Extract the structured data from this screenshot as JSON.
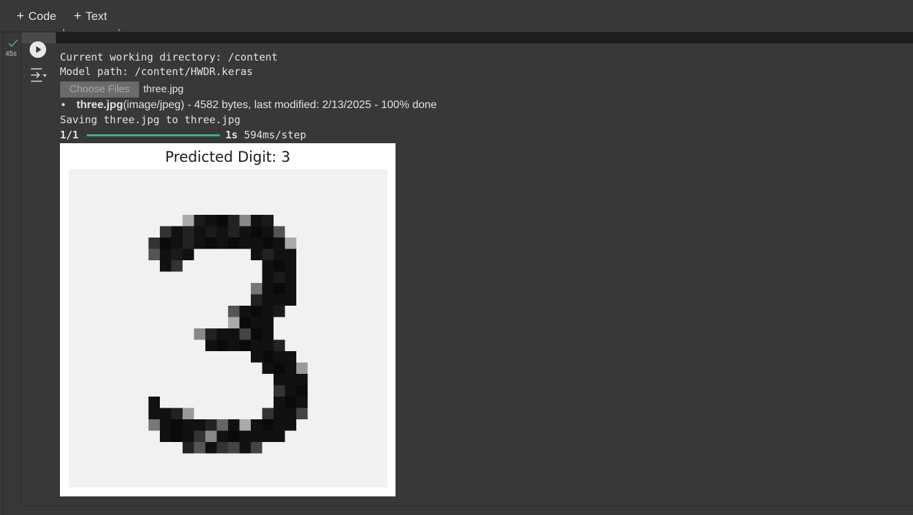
{
  "toolbar": {
    "add_code_label": "Code",
    "add_text_label": "Text",
    "plus_glyph": "+"
  },
  "cell": {
    "execution_time": "45s",
    "status_icon": "check-icon",
    "accent_color": "#39b58f"
  },
  "output": {
    "cwd_line": "Current working directory: /content",
    "model_line": "Model path: /content/HWDR.keras",
    "upload": {
      "button_label": "Choose Files",
      "chosen_file": "three.jpg"
    },
    "file_info": {
      "name": "three.jpg",
      "details": "(image/jpeg) - 4582 bytes, last modified: 2/13/2025 - 100% done"
    },
    "saving_line": "Saving three.jpg to three.jpg",
    "progress": {
      "step": "1/1",
      "fraction": 1.0,
      "elapsed": "1s",
      "per_step": "594ms/step"
    },
    "figure": {
      "title": "Predicted Digit: 3",
      "image_alt": "handwritten digit 3"
    }
  }
}
